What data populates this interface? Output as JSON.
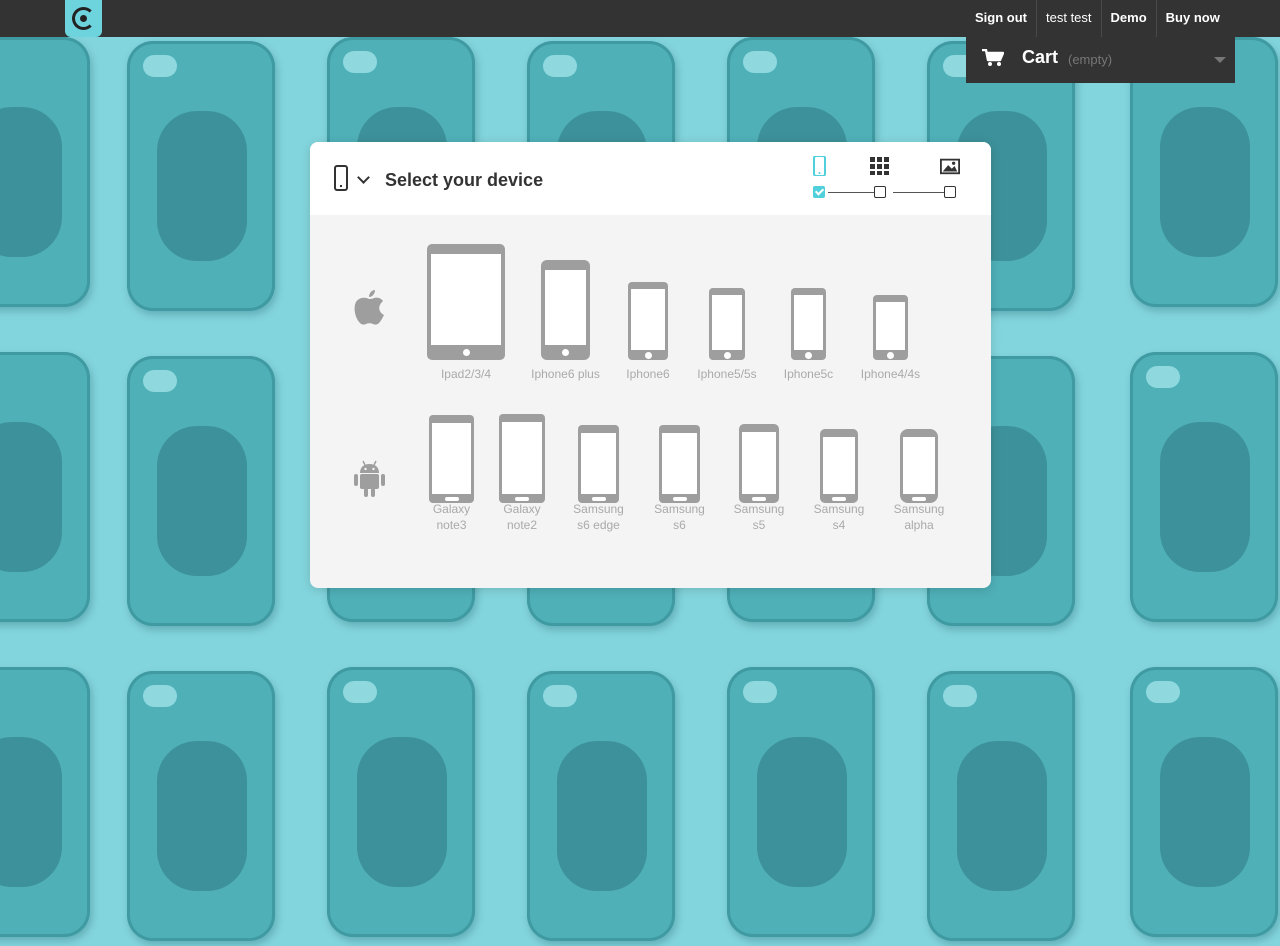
{
  "header": {
    "logo_icon": "c-logo-icon",
    "nav": [
      {
        "label": "Sign out"
      },
      {
        "label": "test test"
      },
      {
        "label": "Demo"
      },
      {
        "label": "Buy now"
      }
    ],
    "cart": {
      "label": "Cart",
      "status": "(empty)",
      "icon": "cart-icon"
    }
  },
  "panel": {
    "title": "Select your device",
    "steps": [
      {
        "icon": "phone-icon",
        "checked": true
      },
      {
        "icon": "grid-icon",
        "checked": false
      },
      {
        "icon": "image-icon",
        "checked": false
      }
    ],
    "apple": {
      "icon": "apple-icon",
      "devices": [
        {
          "line1": "Ipad2/3/4",
          "line2": ""
        },
        {
          "line1": "Iphone6 plus",
          "line2": ""
        },
        {
          "line1": "Iphone6",
          "line2": ""
        },
        {
          "line1": "Iphone5/5s",
          "line2": ""
        },
        {
          "line1": "Iphone5c",
          "line2": ""
        },
        {
          "line1": "Iphone4/4s",
          "line2": ""
        }
      ]
    },
    "android": {
      "icon": "android-icon",
      "devices": [
        {
          "line1": "Galaxy",
          "line2": "note3"
        },
        {
          "line1": "Galaxy",
          "line2": "note2"
        },
        {
          "line1": "Samsung",
          "line2": "s6 edge"
        },
        {
          "line1": "Samsung",
          "line2": "s6"
        },
        {
          "line1": "Samsung",
          "line2": "s5"
        },
        {
          "line1": "Samsung",
          "line2": "s4"
        },
        {
          "line1": "Samsung",
          "line2": "alpha"
        }
      ]
    }
  },
  "colors": {
    "accent": "#4fd0db",
    "topbar": "#333333",
    "device_gray": "#9e9e9e",
    "background": "#83d5dd"
  }
}
